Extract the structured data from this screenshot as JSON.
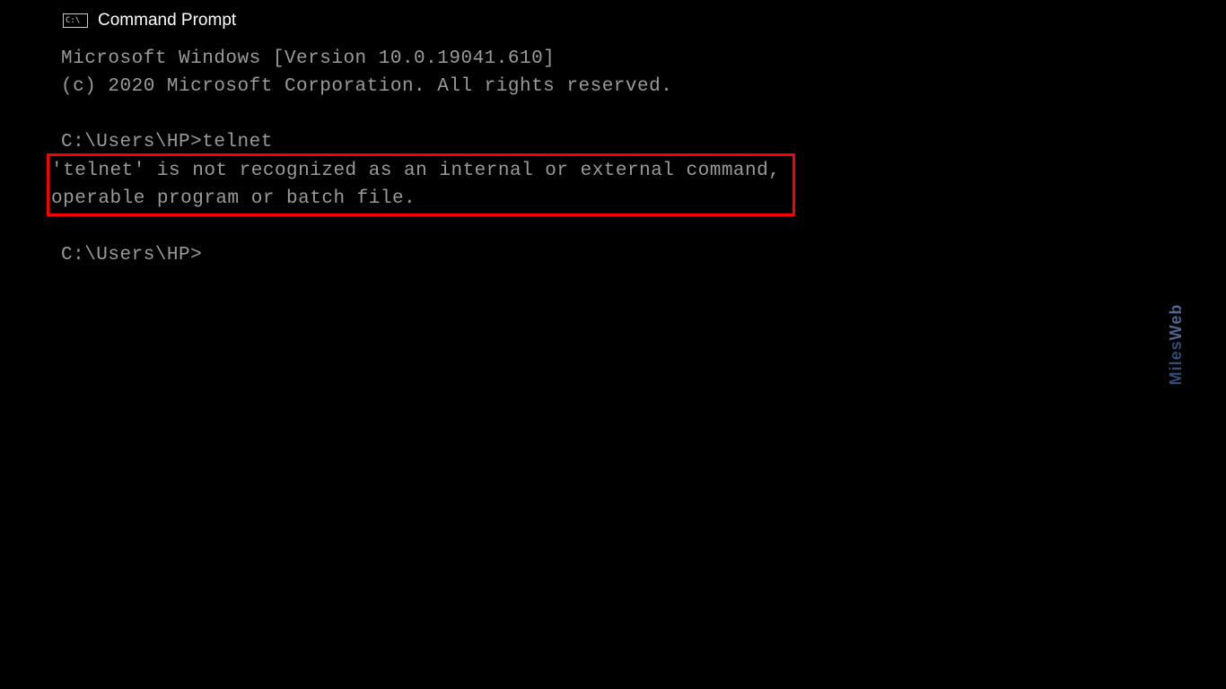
{
  "titlebar": {
    "icon_glyph": "C:\\",
    "title": "Command Prompt"
  },
  "terminal": {
    "version_line": "Microsoft Windows [Version 10.0.19041.610]",
    "copyright_line": "(c) 2020 Microsoft Corporation. All rights reserved.",
    "prompt1_path": "C:\\Users\\HP>",
    "prompt1_command": "telnet",
    "error_line1": "'telnet' is not recognized as an internal or external command,",
    "error_line2": "operable program or batch file.",
    "prompt2_path": "C:\\Users\\HP>"
  },
  "watermark": {
    "line1": "Miles",
    "line2": "Web"
  }
}
